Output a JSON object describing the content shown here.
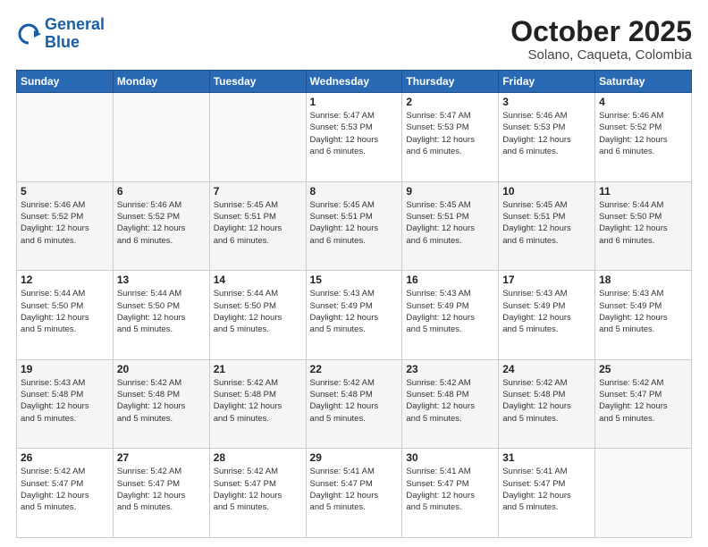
{
  "header": {
    "logo_line1": "General",
    "logo_line2": "Blue",
    "title": "October 2025",
    "subtitle": "Solano, Caqueta, Colombia"
  },
  "weekdays": [
    "Sunday",
    "Monday",
    "Tuesday",
    "Wednesday",
    "Thursday",
    "Friday",
    "Saturday"
  ],
  "weeks": [
    [
      {
        "day": "",
        "info": ""
      },
      {
        "day": "",
        "info": ""
      },
      {
        "day": "",
        "info": ""
      },
      {
        "day": "1",
        "info": "Sunrise: 5:47 AM\nSunset: 5:53 PM\nDaylight: 12 hours\nand 6 minutes."
      },
      {
        "day": "2",
        "info": "Sunrise: 5:47 AM\nSunset: 5:53 PM\nDaylight: 12 hours\nand 6 minutes."
      },
      {
        "day": "3",
        "info": "Sunrise: 5:46 AM\nSunset: 5:53 PM\nDaylight: 12 hours\nand 6 minutes."
      },
      {
        "day": "4",
        "info": "Sunrise: 5:46 AM\nSunset: 5:52 PM\nDaylight: 12 hours\nand 6 minutes."
      }
    ],
    [
      {
        "day": "5",
        "info": "Sunrise: 5:46 AM\nSunset: 5:52 PM\nDaylight: 12 hours\nand 6 minutes."
      },
      {
        "day": "6",
        "info": "Sunrise: 5:46 AM\nSunset: 5:52 PM\nDaylight: 12 hours\nand 6 minutes."
      },
      {
        "day": "7",
        "info": "Sunrise: 5:45 AM\nSunset: 5:51 PM\nDaylight: 12 hours\nand 6 minutes."
      },
      {
        "day": "8",
        "info": "Sunrise: 5:45 AM\nSunset: 5:51 PM\nDaylight: 12 hours\nand 6 minutes."
      },
      {
        "day": "9",
        "info": "Sunrise: 5:45 AM\nSunset: 5:51 PM\nDaylight: 12 hours\nand 6 minutes."
      },
      {
        "day": "10",
        "info": "Sunrise: 5:45 AM\nSunset: 5:51 PM\nDaylight: 12 hours\nand 6 minutes."
      },
      {
        "day": "11",
        "info": "Sunrise: 5:44 AM\nSunset: 5:50 PM\nDaylight: 12 hours\nand 6 minutes."
      }
    ],
    [
      {
        "day": "12",
        "info": "Sunrise: 5:44 AM\nSunset: 5:50 PM\nDaylight: 12 hours\nand 5 minutes."
      },
      {
        "day": "13",
        "info": "Sunrise: 5:44 AM\nSunset: 5:50 PM\nDaylight: 12 hours\nand 5 minutes."
      },
      {
        "day": "14",
        "info": "Sunrise: 5:44 AM\nSunset: 5:50 PM\nDaylight: 12 hours\nand 5 minutes."
      },
      {
        "day": "15",
        "info": "Sunrise: 5:43 AM\nSunset: 5:49 PM\nDaylight: 12 hours\nand 5 minutes."
      },
      {
        "day": "16",
        "info": "Sunrise: 5:43 AM\nSunset: 5:49 PM\nDaylight: 12 hours\nand 5 minutes."
      },
      {
        "day": "17",
        "info": "Sunrise: 5:43 AM\nSunset: 5:49 PM\nDaylight: 12 hours\nand 5 minutes."
      },
      {
        "day": "18",
        "info": "Sunrise: 5:43 AM\nSunset: 5:49 PM\nDaylight: 12 hours\nand 5 minutes."
      }
    ],
    [
      {
        "day": "19",
        "info": "Sunrise: 5:43 AM\nSunset: 5:48 PM\nDaylight: 12 hours\nand 5 minutes."
      },
      {
        "day": "20",
        "info": "Sunrise: 5:42 AM\nSunset: 5:48 PM\nDaylight: 12 hours\nand 5 minutes."
      },
      {
        "day": "21",
        "info": "Sunrise: 5:42 AM\nSunset: 5:48 PM\nDaylight: 12 hours\nand 5 minutes."
      },
      {
        "day": "22",
        "info": "Sunrise: 5:42 AM\nSunset: 5:48 PM\nDaylight: 12 hours\nand 5 minutes."
      },
      {
        "day": "23",
        "info": "Sunrise: 5:42 AM\nSunset: 5:48 PM\nDaylight: 12 hours\nand 5 minutes."
      },
      {
        "day": "24",
        "info": "Sunrise: 5:42 AM\nSunset: 5:48 PM\nDaylight: 12 hours\nand 5 minutes."
      },
      {
        "day": "25",
        "info": "Sunrise: 5:42 AM\nSunset: 5:47 PM\nDaylight: 12 hours\nand 5 minutes."
      }
    ],
    [
      {
        "day": "26",
        "info": "Sunrise: 5:42 AM\nSunset: 5:47 PM\nDaylight: 12 hours\nand 5 minutes."
      },
      {
        "day": "27",
        "info": "Sunrise: 5:42 AM\nSunset: 5:47 PM\nDaylight: 12 hours\nand 5 minutes."
      },
      {
        "day": "28",
        "info": "Sunrise: 5:42 AM\nSunset: 5:47 PM\nDaylight: 12 hours\nand 5 minutes."
      },
      {
        "day": "29",
        "info": "Sunrise: 5:41 AM\nSunset: 5:47 PM\nDaylight: 12 hours\nand 5 minutes."
      },
      {
        "day": "30",
        "info": "Sunrise: 5:41 AM\nSunset: 5:47 PM\nDaylight: 12 hours\nand 5 minutes."
      },
      {
        "day": "31",
        "info": "Sunrise: 5:41 AM\nSunset: 5:47 PM\nDaylight: 12 hours\nand 5 minutes."
      },
      {
        "day": "",
        "info": ""
      }
    ]
  ]
}
